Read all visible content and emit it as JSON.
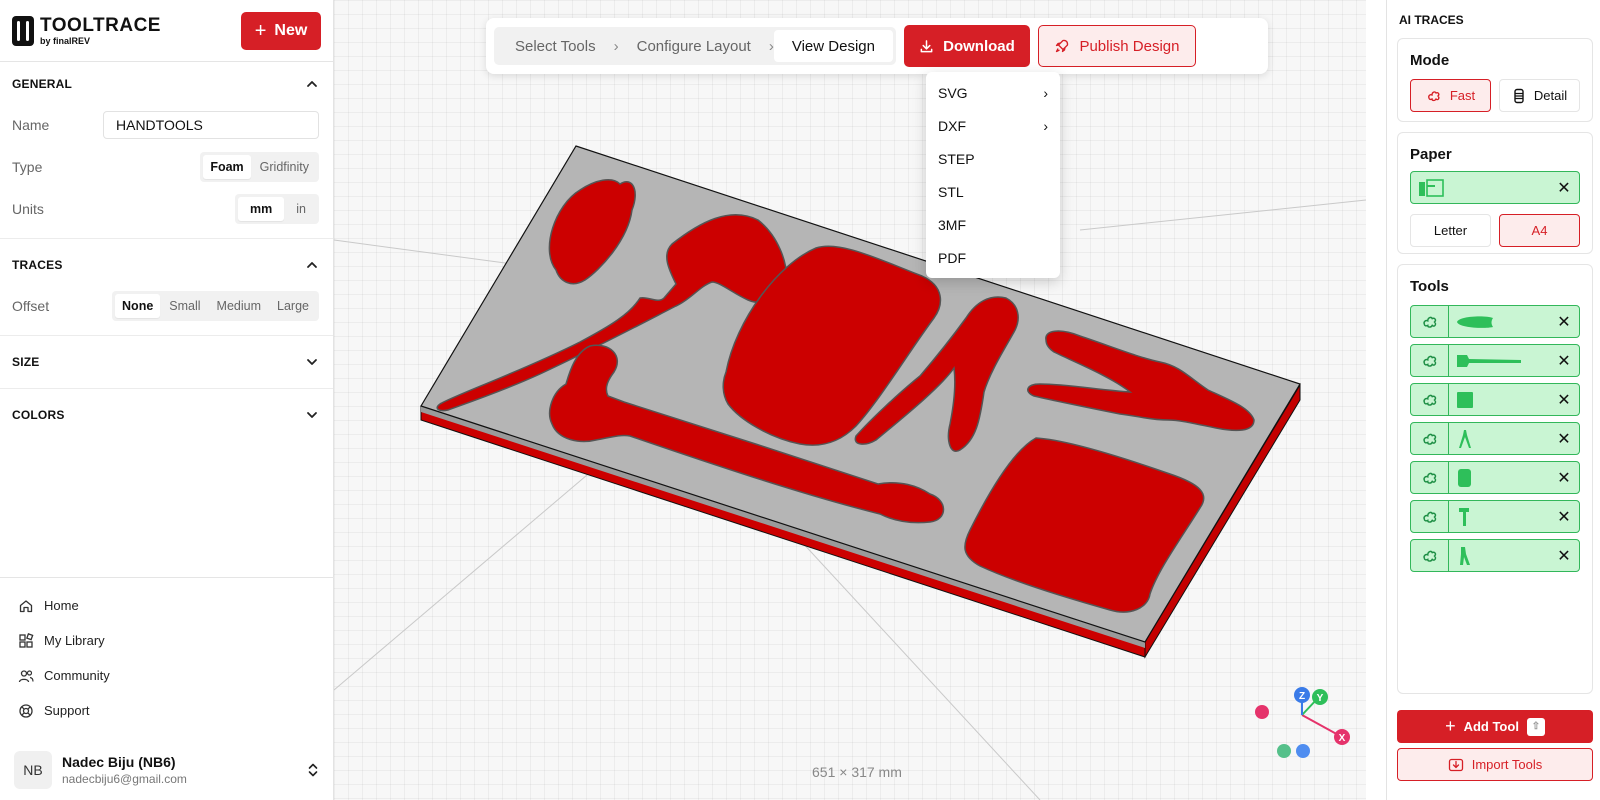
{
  "brand": {
    "title": "TOOLTRACE",
    "subtitle": "by finalREV"
  },
  "new_button": {
    "label": "New"
  },
  "general": {
    "heading": "GENERAL",
    "name_label": "Name",
    "name_value": "HANDTOOLS",
    "type_label": "Type",
    "type_options": [
      "Foam",
      "Gridfinity"
    ],
    "type_selected": "Foam",
    "units_label": "Units",
    "units_options": [
      "mm",
      "in"
    ],
    "units_selected": "mm"
  },
  "traces": {
    "heading": "TRACES",
    "offset_label": "Offset",
    "offset_options": [
      "None",
      "Small",
      "Medium",
      "Large"
    ],
    "offset_selected": "None"
  },
  "size": {
    "heading": "SIZE"
  },
  "colors": {
    "heading": "COLORS"
  },
  "nav": [
    {
      "label": "Home",
      "icon": "home-icon"
    },
    {
      "label": "My Library",
      "icon": "library-icon"
    },
    {
      "label": "Community",
      "icon": "users-icon"
    },
    {
      "label": "Support",
      "icon": "lifebuoy-icon"
    }
  ],
  "user": {
    "initials": "NB",
    "name": "Nadec Biju (NB6)",
    "email": "nadecbiju6@gmail.com"
  },
  "toolbar": {
    "steps": [
      "Select Tools",
      "Configure Layout",
      "View Design"
    ],
    "active_step": "View Design",
    "download_label": "Download",
    "publish_label": "Publish Design"
  },
  "download_menu": [
    {
      "label": "SVG",
      "has_submenu": true
    },
    {
      "label": "DXF",
      "has_submenu": true
    },
    {
      "label": "STEP",
      "has_submenu": false
    },
    {
      "label": "STL",
      "has_submenu": false
    },
    {
      "label": "3MF",
      "has_submenu": false
    },
    {
      "label": "PDF",
      "has_submenu": false
    }
  ],
  "dimensions": "651 × 317 mm",
  "axes": {
    "x": "X",
    "y": "Y",
    "z": "Z"
  },
  "right": {
    "title": "AI TRACES",
    "mode": {
      "title": "Mode",
      "options": [
        "Fast",
        "Detail"
      ],
      "selected": "Fast"
    },
    "paper": {
      "title": "Paper",
      "options": [
        "Letter",
        "A4"
      ],
      "selected": "A4"
    },
    "tools": {
      "title": "Tools",
      "items": [
        "pliers-thumb",
        "hammer-thumb",
        "block-thumb",
        "compass-thumb",
        "case-thumb",
        "screwdriver-thumb",
        "cutter-thumb"
      ]
    },
    "add_tool_label": "Add Tool",
    "add_tool_shortcut": "⇧",
    "import_label": "Import Tools"
  },
  "colors_palette": {
    "accent": "#d61f26",
    "accent_soft": "#fdecec",
    "green": "#32b75a",
    "green_soft": "#c9f5d3",
    "foam": "#b5b5b5",
    "pocket": "#cc0000"
  }
}
